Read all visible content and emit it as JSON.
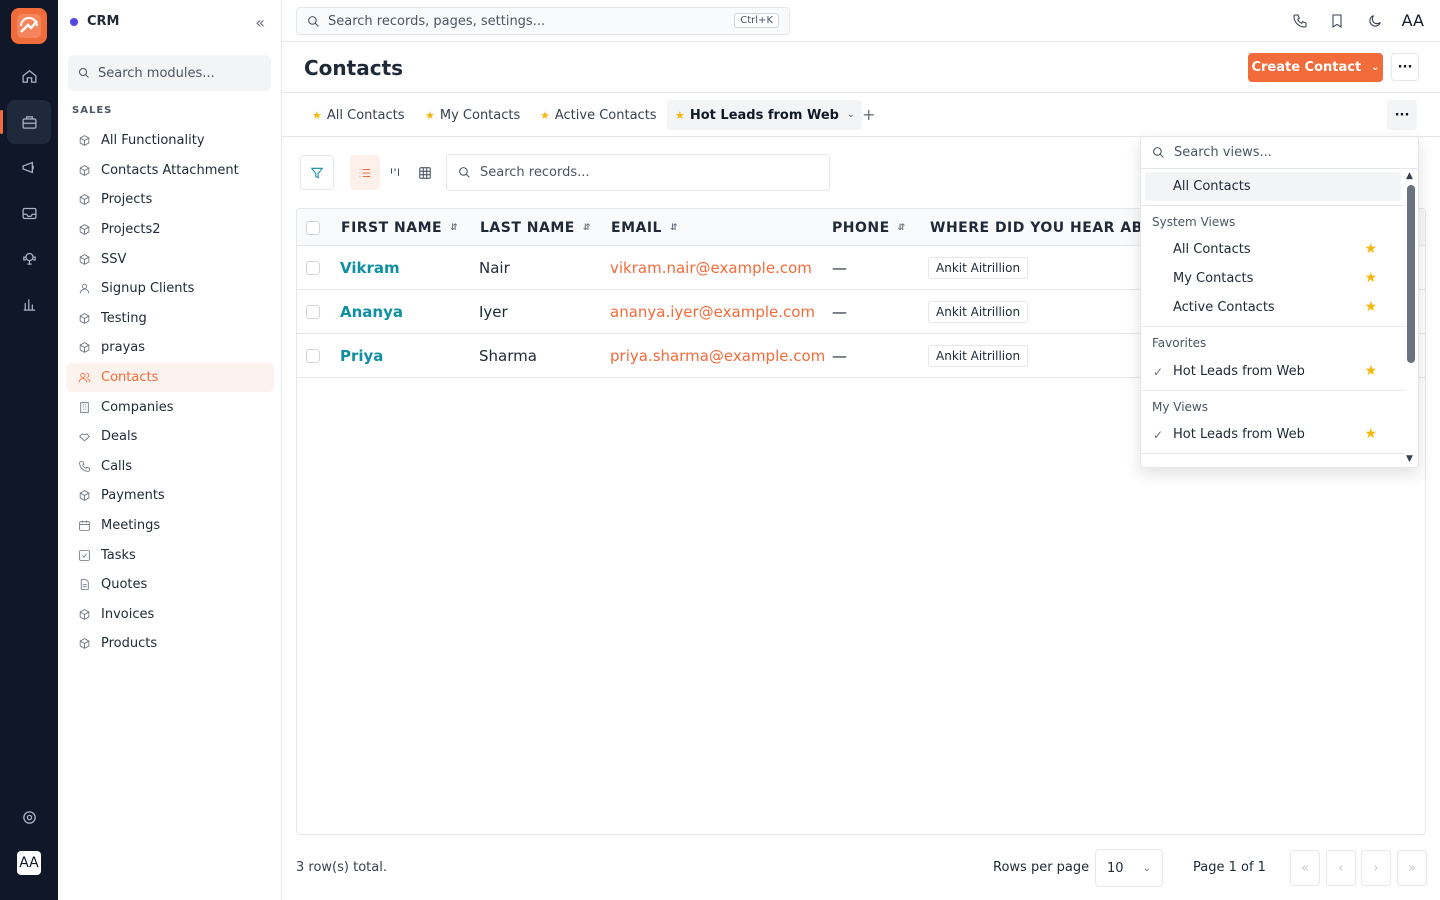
{
  "rail": {
    "items": [
      "home-icon",
      "briefcase-icon",
      "megaphone-icon",
      "inbox-icon",
      "support-icon",
      "chart-icon"
    ],
    "avatar": "AA"
  },
  "sidebar": {
    "brand": "CRM",
    "search_placeholder": "Search modules...",
    "section": "SALES",
    "items": [
      {
        "label": "All Functionality",
        "icon": "cube-icon"
      },
      {
        "label": "Contacts Attachment",
        "icon": "cube-icon"
      },
      {
        "label": "Projects",
        "icon": "cube-icon"
      },
      {
        "label": "Projects2",
        "icon": "cube-icon"
      },
      {
        "label": "SSV",
        "icon": "cube-icon"
      },
      {
        "label": "Signup Clients",
        "icon": "user-icon"
      },
      {
        "label": "Testing",
        "icon": "cube-icon"
      },
      {
        "label": "prayas",
        "icon": "cube-icon"
      },
      {
        "label": "Contacts",
        "icon": "users-icon"
      },
      {
        "label": "Companies",
        "icon": "building-icon"
      },
      {
        "label": "Deals",
        "icon": "handshake-icon"
      },
      {
        "label": "Calls",
        "icon": "phone-icon"
      },
      {
        "label": "Payments",
        "icon": "cube-icon"
      },
      {
        "label": "Meetings",
        "icon": "calendar-icon"
      },
      {
        "label": "Tasks",
        "icon": "task-icon"
      },
      {
        "label": "Quotes",
        "icon": "document-icon"
      },
      {
        "label": "Invoices",
        "icon": "cube-icon"
      },
      {
        "label": "Products",
        "icon": "cube-icon"
      }
    ]
  },
  "topbar": {
    "search_placeholder": "Search records, pages, settings...",
    "shortcut": "Ctrl+K",
    "avatar": "AA"
  },
  "header": {
    "title": "Contacts",
    "create_label": "Create Contact",
    "more": "···"
  },
  "tabs": [
    {
      "label": "All Contacts",
      "active": false
    },
    {
      "label": "My Contacts",
      "active": false
    },
    {
      "label": "Active Contacts",
      "active": false
    },
    {
      "label": "Hot Leads from Web",
      "active": true
    }
  ],
  "toolbar": {
    "search_placeholder": "Search records..."
  },
  "table": {
    "columns": [
      "FIRST NAME",
      "LAST NAME",
      "EMAIL",
      "PHONE",
      "WHERE DID YOU HEAR ABO"
    ],
    "rows": [
      {
        "first": "Vikram",
        "last": "Nair",
        "email": "vikram.nair@example.com",
        "phone": "—",
        "source": "Ankit Aitrillion"
      },
      {
        "first": "Ananya",
        "last": "Iyer",
        "email": "ananya.iyer@example.com",
        "phone": "—",
        "source": "Ankit Aitrillion"
      },
      {
        "first": "Priya",
        "last": "Sharma",
        "email": "priya.sharma@example.com",
        "phone": "—",
        "source": "Ankit Aitrillion"
      }
    ]
  },
  "footer": {
    "total": "3 row(s) total.",
    "rows_per_page_label": "Rows per page",
    "rows_per_page": "10",
    "page_info": "Page 1 of 1"
  },
  "views_dropdown": {
    "search_placeholder": "Search views...",
    "highlighted": "All Contacts",
    "groups": [
      {
        "title": "System Views",
        "items": [
          "All Contacts",
          "My Contacts",
          "Active Contacts"
        ]
      },
      {
        "title": "Favorites",
        "items": [
          "Hot Leads from Web"
        ]
      },
      {
        "title": "My Views",
        "items": [
          "Hot Leads from Web"
        ]
      }
    ]
  },
  "colors": {
    "accent": "#f26b3a",
    "link": "#0f8fa3",
    "rail": "#0f1729",
    "star": "#f5b70a"
  }
}
